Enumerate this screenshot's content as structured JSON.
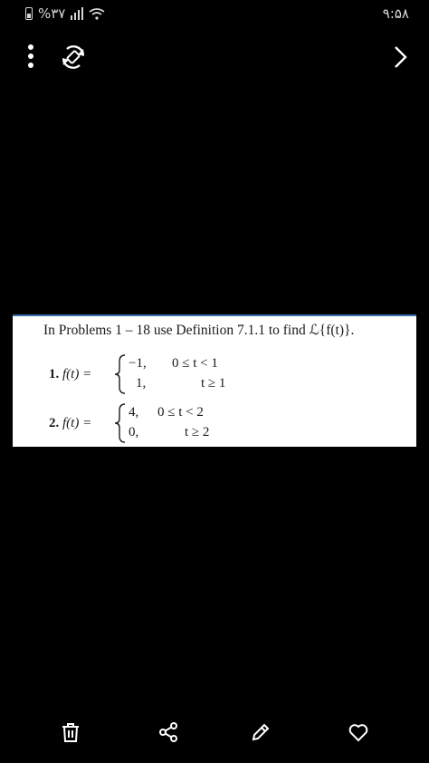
{
  "status_bar": {
    "battery_text": "%۳۷",
    "time": "۹:۵۸"
  },
  "toolbar": {
    "menu_icon": "more-vertical-icon",
    "rotate_icon": "rotate-icon",
    "next_icon": "chevron-right-icon"
  },
  "document": {
    "heading": "In Problems 1 – 18 use Definition 7.1.1 to find ℒ{f(t)}.",
    "problems": [
      {
        "number": "1.",
        "func": "f(t) =",
        "cases": [
          {
            "value": "−1,",
            "condition": "0 ≤ t < 1"
          },
          {
            "value": "1,",
            "condition": "t ≥ 1"
          }
        ]
      },
      {
        "number": "2.",
        "func": "f(t) =",
        "cases": [
          {
            "value": "4,",
            "condition": "0 ≤ t < 2"
          },
          {
            "value": "0,",
            "condition": "t ≥ 2"
          }
        ]
      }
    ]
  },
  "bottom_bar": {
    "icons": [
      "trash-icon",
      "share-icon",
      "edit-icon",
      "heart-icon"
    ]
  }
}
